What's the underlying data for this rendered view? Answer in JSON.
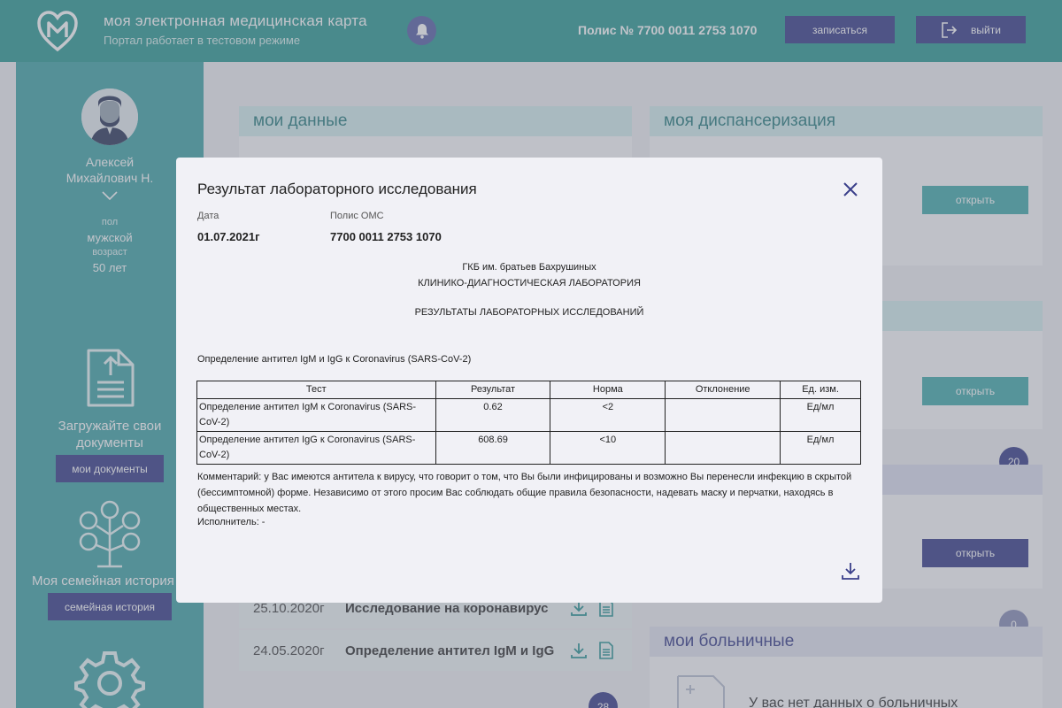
{
  "header": {
    "app_title": "моя электронная медицинская карта",
    "app_subtitle": "Портал работает в тестовом режиме",
    "polis": "Полис № 7700 0011 2753 1070",
    "signup_label": "записаться",
    "logout_label": "выйти",
    "brand_color": "#2f9c95"
  },
  "sidebar": {
    "user_first": "Алексей",
    "user_last": "Михайлович Н.",
    "gender_label": "пол",
    "gender_value": "мужской",
    "age_label": "возраст",
    "age_value": "50 лет",
    "upload_line1": "Загружайте свои",
    "upload_line2": "документы",
    "docs_button": "мои документы",
    "family_text": "Моя семейная история",
    "family_button": "семейная история"
  },
  "cards": {
    "my_data_title": "мои данные",
    "dispensary_title": "моя диспансеризация",
    "open_label": "открыть",
    "badge_20": "20",
    "badge_0": "0",
    "badge_28": "28",
    "sick_leave_title": "мои больничные",
    "sick_leave_empty": "У вас нет данных о больничных"
  },
  "history": [
    {
      "date": "25.10.2020г",
      "name": "Исследование на коронавирус"
    },
    {
      "date": "24.05.2020г",
      "name": "Определение антител IgM и IgG"
    }
  ],
  "modal": {
    "title": "Результат лабораторного исследования",
    "date_label": "Дата",
    "date_value": "01.07.2021г",
    "polis_label": "Полис ОМС",
    "polis_value": "7700 0011 2753 1070",
    "hospital": "ГКБ им. братьев Бахрушиных",
    "lab": "КЛИНИКО-ДИАГНОСТИЧЕСКАЯ ЛАБОРАТОРИЯ",
    "results_heading": "РЕЗУЛЬТАТЫ ЛАБОРАТОРНЫХ ИССЛЕДОВАНИЙ",
    "subject": "Определение антител IgM и IgG к Coronavirus (SARS-CoV-2)",
    "table": {
      "headers": [
        "Тест",
        "Результат",
        "Норма",
        "Отклонение",
        "Ед. изм."
      ],
      "rows": [
        [
          "Определение антител IgM к Coronavirus (SARS-CoV-2)",
          "0.62",
          "<2",
          "",
          "Ед/мл"
        ],
        [
          "Определение антител IgG к Coronavirus (SARS-CoV-2)",
          "608.69",
          "<10",
          "",
          "Ед/мл"
        ]
      ]
    },
    "comment": "Комментарий: у Вас имеются антитела к вирусу, что говорит о том, что Вы были инфицированы и возможно Вы перенесли инфекцию в скрытой (бессимптомной) форме. Независимо от этого просим Вас соблюдать общие правила безопасности, надевать маску и перчатки, находясь в общественных местах.",
    "executor": "Исполнитель: -"
  }
}
